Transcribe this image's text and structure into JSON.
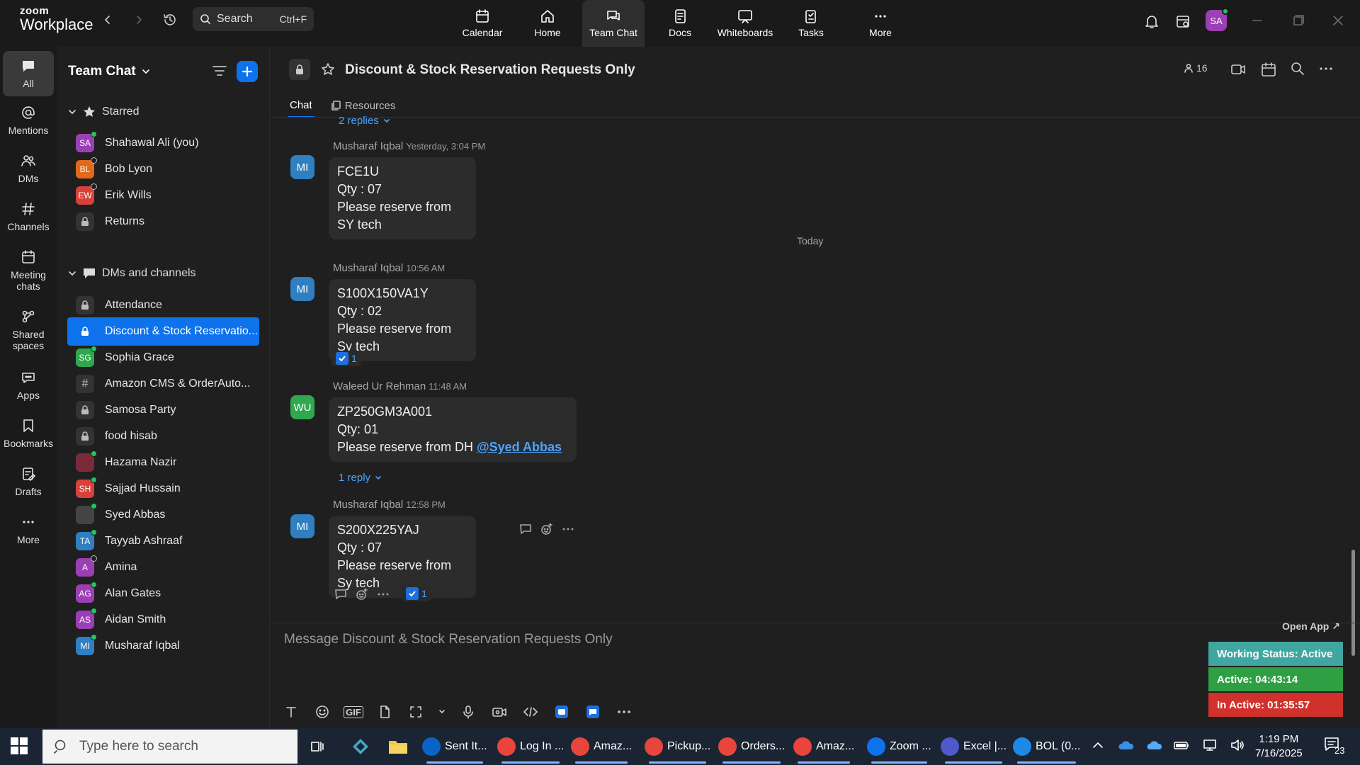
{
  "app": {
    "brand_line1": "zoom",
    "brand_line2": "Workplace",
    "search_placeholder": "Search",
    "search_shortcut": "Ctrl+F",
    "nav": [
      {
        "label": "Calendar",
        "icon": "calendar-icon"
      },
      {
        "label": "Home",
        "icon": "home-icon"
      },
      {
        "label": "Team Chat",
        "icon": "chat-icon"
      },
      {
        "label": "Docs",
        "icon": "docs-icon"
      },
      {
        "label": "Whiteboards",
        "icon": "whiteboard-icon"
      },
      {
        "label": "Tasks",
        "icon": "tasks-icon"
      },
      {
        "label": "More",
        "icon": "more-icon"
      }
    ],
    "avatar_initials": "SA"
  },
  "rail": [
    {
      "label": "All",
      "icon": "chat-bubble-icon"
    },
    {
      "label": "Mentions",
      "icon": "at-icon"
    },
    {
      "label": "DMs",
      "icon": "people-icon"
    },
    {
      "label": "Channels",
      "icon": "hash-icon"
    },
    {
      "label": "Meeting chats",
      "icon": "meeting-icon"
    },
    {
      "label": "Shared spaces",
      "icon": "share-icon"
    },
    {
      "label": "Apps",
      "icon": "apps-icon"
    },
    {
      "label": "Bookmarks",
      "icon": "bookmark-icon"
    },
    {
      "label": "Drafts",
      "icon": "draft-icon"
    },
    {
      "label": "More",
      "icon": "more-icon"
    }
  ],
  "sidebar": {
    "title": "Team Chat",
    "starred_label": "Starred",
    "starred": [
      {
        "name": "Shahawal Ali (you)",
        "initials": "SA",
        "color": "#9b3fb5",
        "status": "online"
      },
      {
        "name": "Bob Lyon",
        "initials": "BL",
        "color": "#e0691a",
        "status": "away"
      },
      {
        "name": "Erik Wills",
        "initials": "EW",
        "color": "#d9413a",
        "status": "away"
      },
      {
        "name": "Returns",
        "type": "private"
      }
    ],
    "dms_label": "DMs and channels",
    "items": [
      {
        "name": "Attendance",
        "type": "private"
      },
      {
        "name": "Discount & Stock Reservatio...",
        "type": "private",
        "active": true
      },
      {
        "name": "Sophia Grace",
        "initials": "SG",
        "color": "#2fa84f",
        "status": "online"
      },
      {
        "name": "Amazon CMS & OrderAuto...",
        "type": "public"
      },
      {
        "name": "Samosa Party",
        "type": "private"
      },
      {
        "name": "food hisab",
        "type": "private"
      },
      {
        "name": "Hazama Nazir",
        "initials": "",
        "color": "#7a2b3a",
        "status": "online"
      },
      {
        "name": "Sajjad Hussain",
        "initials": "SH",
        "color": "#d9413a",
        "status": "online"
      },
      {
        "name": "Syed Abbas",
        "initials": "",
        "color": "#444444",
        "status": "online"
      },
      {
        "name": "Tayyab Ashraaf",
        "initials": "TA",
        "color": "#2f7fc1",
        "status": "online"
      },
      {
        "name": "Amina",
        "initials": "A",
        "color": "#9b3fb5",
        "status": "away"
      },
      {
        "name": "Alan Gates",
        "initials": "AG",
        "color": "#9b3fb5",
        "status": "online"
      },
      {
        "name": "Aidan Smith",
        "initials": "AS",
        "color": "#9b3fb5",
        "status": "online"
      },
      {
        "name": "Musharaf Iqbal",
        "initials": "MI",
        "color": "#2f7fc1",
        "status": "online"
      }
    ]
  },
  "channel": {
    "title": "Discount & Stock Reservation Requests Only",
    "members": "16",
    "tabs": [
      "Chat",
      "Resources"
    ],
    "top_replies": "2 replies",
    "today_label": "Today",
    "composer_placeholder": "Message Discount & Stock Reservation Requests Only",
    "messages": [
      {
        "sender": "Musharaf Iqbal",
        "time": "Yesterday, 3:04 PM",
        "initials": "MI",
        "color": "#2f7fc1",
        "lines": [
          "FCE1U",
          "Qty : 07",
          "Please reserve from SY tech"
        ]
      },
      {
        "sender": "Musharaf Iqbal",
        "time": "10:56 AM",
        "initials": "MI",
        "color": "#2f7fc1",
        "lines": [
          "S100X150VA1Y",
          "Qty : 02",
          "Please reserve from Sy tech"
        ],
        "reaction_count": "1"
      },
      {
        "sender": "Waleed Ur Rehman",
        "time": "11:48 AM",
        "initials": "WU",
        "color": "#2fa84f",
        "lines": [
          "ZP250GM3A001",
          "Qty: 01",
          "Please reserve from DH "
        ],
        "mention": "@Syed Abbas",
        "replies": "1 reply"
      },
      {
        "sender": "Musharaf Iqbal",
        "time": "12:58 PM",
        "initials": "MI",
        "color": "#2f7fc1",
        "lines": [
          "S200X225YAJ",
          "Qty : 07",
          "Please reserve from Sy tech"
        ],
        "reaction_count": "1"
      }
    ]
  },
  "widget": {
    "open_app": "Open App ↗",
    "working_status": "Working Status: Active",
    "active": "Active: 04:43:14",
    "inactive": "In Active: 01:35:57",
    "colors": {
      "working": "#3fa7a0",
      "active": "#2ea043",
      "inactive": "#d0312d"
    }
  },
  "taskbar": {
    "search_placeholder": "Type here to search",
    "apps": [
      {
        "label": "Sent It...",
        "color": "#0a64c8"
      },
      {
        "label": "Log In ...",
        "color": "#e8453c"
      },
      {
        "label": "Amaz...",
        "color": "#e8453c"
      },
      {
        "label": "Pickup...",
        "color": "#e8453c"
      },
      {
        "label": "Orders...",
        "color": "#e8453c"
      },
      {
        "label": "Amaz...",
        "color": "#e8453c"
      },
      {
        "label": "Zoom ...",
        "color": "#0e72ed"
      },
      {
        "label": "Excel |...",
        "color": "#5059c9"
      },
      {
        "label": "BOL (0...",
        "color": "#1e88e5"
      }
    ],
    "time": "1:19 PM",
    "date": "7/16/2025",
    "notifications": "23"
  }
}
